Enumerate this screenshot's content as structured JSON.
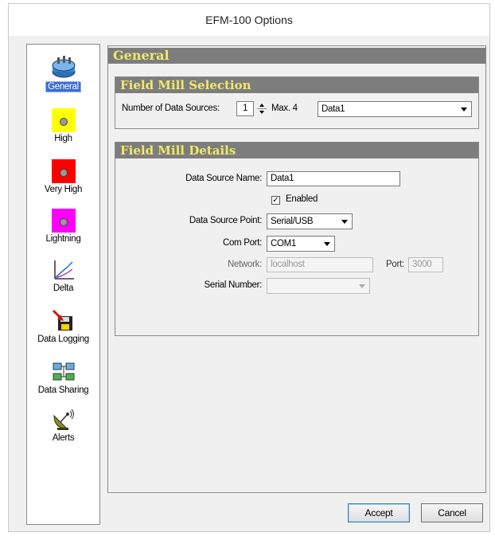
{
  "window": {
    "title": "EFM-100 Options"
  },
  "nav": {
    "items": [
      {
        "label": "General",
        "icon": "network-hub-icon",
        "selected": true
      },
      {
        "label": "High",
        "icon": "yellow-alarm-icon",
        "color": "#ffff00"
      },
      {
        "label": "Very High",
        "icon": "red-alarm-icon",
        "color": "#ff0000"
      },
      {
        "label": "Lightning",
        "icon": "magenta-alarm-icon",
        "color": "#ff00ff"
      },
      {
        "label": "Delta",
        "icon": "delta-chart-icon"
      },
      {
        "label": "Data Logging",
        "icon": "data-logging-icon"
      },
      {
        "label": "Data Sharing",
        "icon": "data-sharing-icon"
      },
      {
        "label": "Alerts",
        "icon": "satellite-dish-icon"
      }
    ]
  },
  "main": {
    "section_title": "General",
    "selection": {
      "title": "Field Mill Selection",
      "num_sources_label": "Number of Data Sources:",
      "num_sources_value": "1",
      "max_label": "Max. 4",
      "source_select_value": "Data1"
    },
    "details": {
      "title": "Field Mill Details",
      "name_label": "Data Source Name:",
      "name_value": "Data1",
      "enabled_label": "Enabled",
      "enabled_checked": true,
      "point_label": "Data Source Point:",
      "point_value": "Serial/USB",
      "com_label": "Com Port:",
      "com_value": "COM1",
      "network_label": "Network:",
      "network_value": "localhost",
      "port_label": "Port:",
      "port_value": "3000",
      "serial_label": "Serial Number:",
      "serial_value": ""
    }
  },
  "buttons": {
    "accept": "Accept",
    "cancel": "Cancel"
  },
  "colors": {
    "section_bar": "#7d7d7d",
    "section_text": "#f1e96a",
    "selection": "#3a6cd4"
  }
}
